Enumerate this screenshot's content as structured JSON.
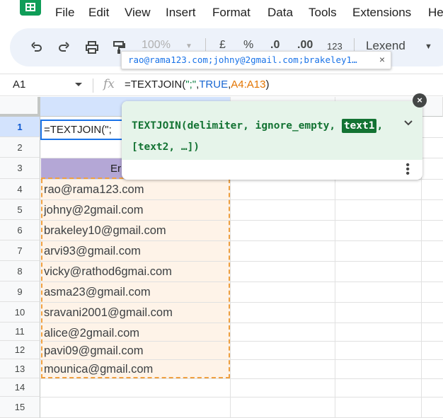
{
  "menu": [
    "File",
    "Edit",
    "View",
    "Insert",
    "Format",
    "Data",
    "Tools",
    "Extensions",
    "He"
  ],
  "toolbar": {
    "undo_icon": "undo-icon",
    "redo_icon": "redo-icon",
    "print_icon": "print-icon",
    "paint_format_icon": "paint-format-icon",
    "zoom": "100%",
    "currency": "£",
    "percent": "%",
    "dec_decrease": ".0",
    "dec_increase": ".00",
    "number_format": "123",
    "font": "Lexend"
  },
  "result_tooltip": {
    "text": "rao@rama123.com;johny@2gmail.com;brakeley1…",
    "close": "×"
  },
  "formula_bar": {
    "cell_ref": "A1",
    "fx": "fx",
    "formula_parts": {
      "func": "=TEXTJOIN(",
      "delim": "\";\"",
      "comma1": ",",
      "bool": "TRUE",
      "comma2": ",",
      "range": "A4:A13",
      "close": ")"
    }
  },
  "function_help": {
    "sig_before": "TEXTJOIN(delimiter, ignore_empty, ",
    "sig_highlight": "text1",
    "sig_after": ",",
    "sig_line2": "[text2, …])",
    "close": "×"
  },
  "grid": {
    "active_cell_text": "=TEXTJOIN(\";",
    "header_text": "Er",
    "rows": [
      "1",
      "2",
      "3",
      "4",
      "5",
      "6",
      "7",
      "8",
      "9",
      "10",
      "11",
      "12",
      "13",
      "14",
      "15"
    ],
    "emails": [
      "rao@rama123.com",
      "johny@2gmail.com",
      "brakeley10@gmail.com",
      "arvi93@gmail.com",
      "vicky@rathod6gmai.com",
      "asma23@gmail.com",
      "sravani2001@gmail.com",
      "alice@2gmail.com",
      "pavi09@gmail.com",
      "mounica@gmail.com"
    ]
  },
  "colors": {
    "header_fill": "#b4a7d6",
    "email_fill": "#fef3e8",
    "selection_border": "#1a73e8",
    "copy_dash": "#f0a040",
    "help_bg": "#e6f4ea"
  }
}
